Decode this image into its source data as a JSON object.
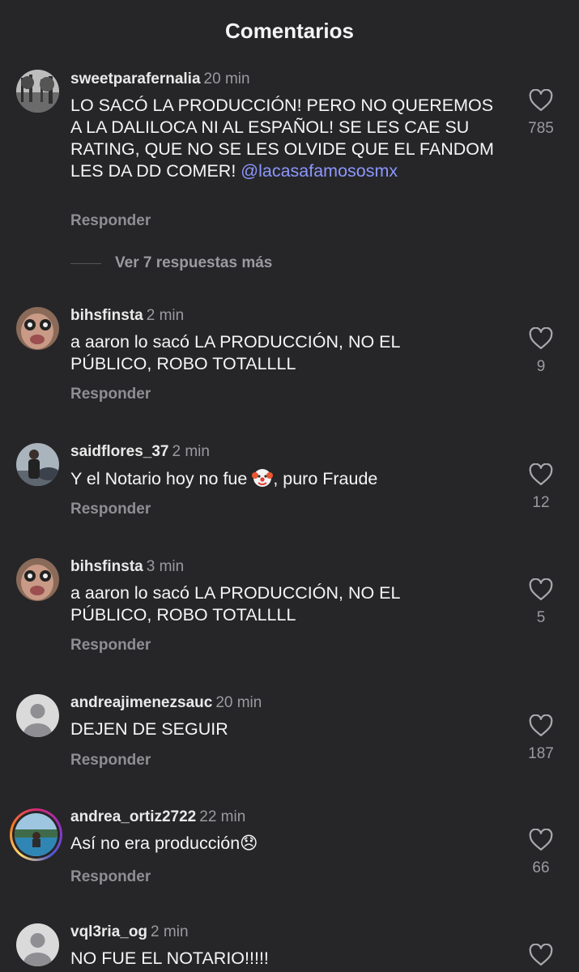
{
  "header": {
    "title": "Comentarios"
  },
  "comments": [
    {
      "username": "sweetparafernalia",
      "time": "20 min",
      "text": "LO SACÓ LA PRODUCCIÓN! PERO NO QUEREMOS A LA DALILOCA NI AL ESPAÑOL! SE LES CAE SU RATING, QUE NO SE LES OLVIDE QUE EL FANDOM LES DA DD COMER!",
      "mention": "@lacasafamososmx",
      "reply_label": "Responder",
      "likes": "785",
      "more_replies": "Ver 7 respuestas más"
    },
    {
      "username": "bihsfinsta",
      "time": "2 min",
      "text": "a aaron lo sacó LA PRODUCCIÓN, NO EL PÚBLICO, ROBO TOTALLLL",
      "reply_label": "Responder",
      "likes": "9"
    },
    {
      "username": "saidflores_37",
      "time": "2 min",
      "text_before": "Y el Notario hoy no fue ",
      "emoji": "clown-face",
      "text_after": ", puro Fraude",
      "reply_label": "Responder",
      "likes": "12"
    },
    {
      "username": "bihsfinsta",
      "time": "3 min",
      "text": "a aaron lo sacó LA PRODUCCIÓN, NO EL PÚBLICO, ROBO TOTALLLL",
      "reply_label": "Responder",
      "likes": "5"
    },
    {
      "username": "andreajimenezsauc",
      "time": "20 min",
      "text": "DEJEN DE SEGUIR",
      "reply_label": "Responder",
      "likes": "187"
    },
    {
      "username": "andrea_ortiz2722",
      "time": "22 min",
      "text": "Así no era producción😞",
      "reply_label": "Responder",
      "likes": "66"
    },
    {
      "username": "vql3ria_og",
      "time": "2 min",
      "text": "NO FUE EL NOTARIO!!!!!"
    }
  ],
  "icons": {
    "like": "heart-outline-icon",
    "default_avatar": "person-silhouette-icon"
  },
  "colors": {
    "background": "#262628",
    "mention": "#8c97ff",
    "secondary_text": "#9a9aa0"
  }
}
